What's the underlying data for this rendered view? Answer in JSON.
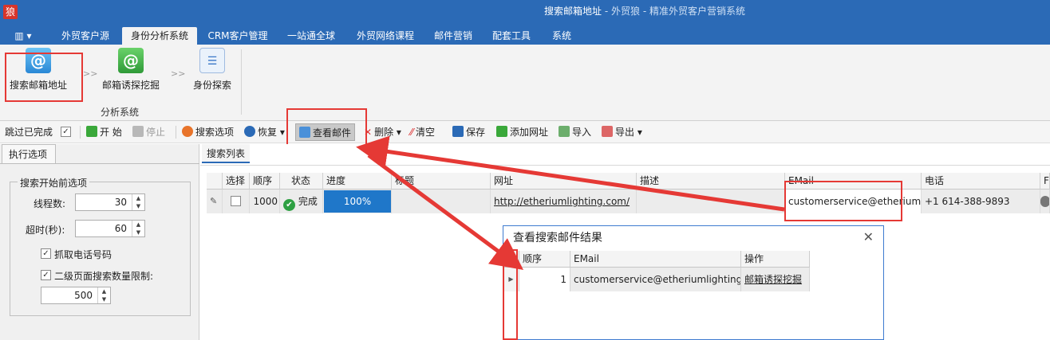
{
  "window": {
    "icon_text": "狼",
    "title_main": "搜索邮箱地址",
    "title_rest": " - 外贸狼 - 精准外贸客户营销系统"
  },
  "menu": {
    "tabs": [
      {
        "label": "外贸客户源"
      },
      {
        "label": "身份分析系统"
      },
      {
        "label": "CRM客户管理"
      },
      {
        "label": "一站通全球"
      },
      {
        "label": "外贸网络课程"
      },
      {
        "label": "邮件营销"
      },
      {
        "label": "配套工具"
      },
      {
        "label": "系统"
      }
    ],
    "active": "身份分析系统"
  },
  "ribbon": {
    "buttons": [
      {
        "label": "搜索邮箱地址",
        "icon": "email-at-icon"
      },
      {
        "label": "邮箱诱探挖掘",
        "icon": "email-dig-icon"
      },
      {
        "label": "身份探索",
        "icon": "id-card-icon"
      }
    ],
    "arrows": ">>",
    "group_label": "分析系统"
  },
  "toolbar": {
    "skip_done": "跳过已完成",
    "skip_checked": "✓",
    "start": "开 始",
    "stop": "停止",
    "options": "搜索选项",
    "restore": "恢复",
    "view_mail": "查看邮件",
    "delete": "删除",
    "clear": "清空",
    "save": "保存",
    "add_url": "添加网址",
    "import": "导入",
    "export": "导出"
  },
  "left": {
    "tab": "执行选项",
    "group": "搜索开始前选项",
    "threads_label": "线程数:",
    "threads": "30",
    "timeout_label": "超时(秒):",
    "timeout": "60",
    "grab_phone": "抓取电话号码",
    "limit_second": "二级页面搜索数量限制:",
    "limit_value": "500",
    "check": "✓"
  },
  "grid": {
    "tab": "搜索列表",
    "columns": [
      "选择",
      "顺序",
      "状态",
      "进度",
      "标题",
      "网址",
      "描述",
      "EMail",
      "电话",
      "F"
    ],
    "row": {
      "order": "1000",
      "status": "完成",
      "progress": "100%",
      "title": "",
      "url": "http://etheriumlighting.com/",
      "desc": "",
      "email": "customerservice@etheriumlighting.com",
      "phone": "+1 614-388-9893",
      "edit_glyph": "✎",
      "ok_glyph": "✔"
    }
  },
  "dialog": {
    "title": "查看搜索邮件结果",
    "close": "✕",
    "columns": [
      "顺序",
      "EMail",
      "操作"
    ],
    "row": {
      "order": "1",
      "email": "customerservice@etheriumlighting....",
      "action": "邮箱诱探挖掘"
    }
  },
  "colors": {
    "titlebar": "#2b6ab6",
    "highlight": "#e53935",
    "progress": "#1f77c9"
  }
}
